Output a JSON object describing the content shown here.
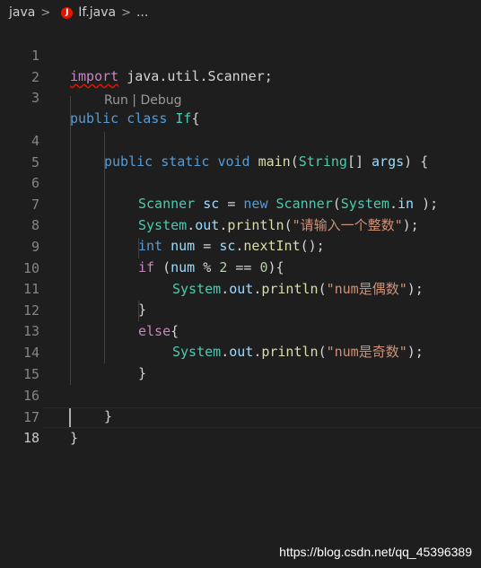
{
  "breadcrumb": {
    "folder": "java",
    "file": "If.java",
    "more": "..."
  },
  "codelens": "Run | Debug",
  "line_numbers": [
    "1",
    "2",
    "3",
    "4",
    "5",
    "6",
    "7",
    "8",
    "9",
    "10",
    "11",
    "12",
    "13",
    "14",
    "15",
    "16",
    "17",
    "18"
  ],
  "code": {
    "l1": {
      "kw": "import",
      "rest": " java.util.Scanner;"
    },
    "l3": {
      "kw1": "public",
      "kw2": "class",
      "name": "If",
      "brace": "{"
    },
    "l4": {
      "kw1": "public",
      "kw2": "static",
      "kw3": "void",
      "fn": "main",
      "type": "String",
      "param": "args",
      "tail": ") {"
    },
    "l6": {
      "type": "Scanner",
      "var": "sc",
      "op": " = ",
      "kw": "new",
      "type2": "Scanner",
      "arg1": "System",
      "arg2": "in",
      "tail": " );"
    },
    "l7": {
      "obj": "System",
      "field": "out",
      "fn": "println",
      "str": "\"请输入一个整数\"",
      "tail": ");"
    },
    "l8": {
      "kw": "int",
      "var": "num",
      "obj": "sc",
      "fn": "nextInt",
      "tail": "();"
    },
    "l9": {
      "kw": "if",
      "var": "num",
      "num1": "2",
      "num2": "0",
      "tail": "){"
    },
    "l10": {
      "obj": "System",
      "field": "out",
      "fn": "println",
      "str": "\"num是偶数\"",
      "tail": ");"
    },
    "l11": {
      "brace": "}"
    },
    "l12": {
      "kw": "else",
      "brace": "{"
    },
    "l13": {
      "obj": "System",
      "field": "out",
      "fn": "println",
      "str": "\"num是奇数\"",
      "tail": ");"
    },
    "l14": {
      "brace": "}"
    },
    "l16": {
      "brace": "}"
    },
    "l17": {
      "brace": "}"
    }
  },
  "watermark": "https://blog.csdn.net/qq_45396389",
  "colors": {
    "background": "#1e1e1e",
    "keyword": "#569cd6",
    "control": "#c586c0",
    "type": "#4ec9b0",
    "variable": "#9cdcfe",
    "function": "#dcdcaa",
    "string": "#ce9178",
    "number": "#b5cea8",
    "error": "#e51400"
  },
  "icons": {
    "file_icon": "java-error-icon"
  }
}
